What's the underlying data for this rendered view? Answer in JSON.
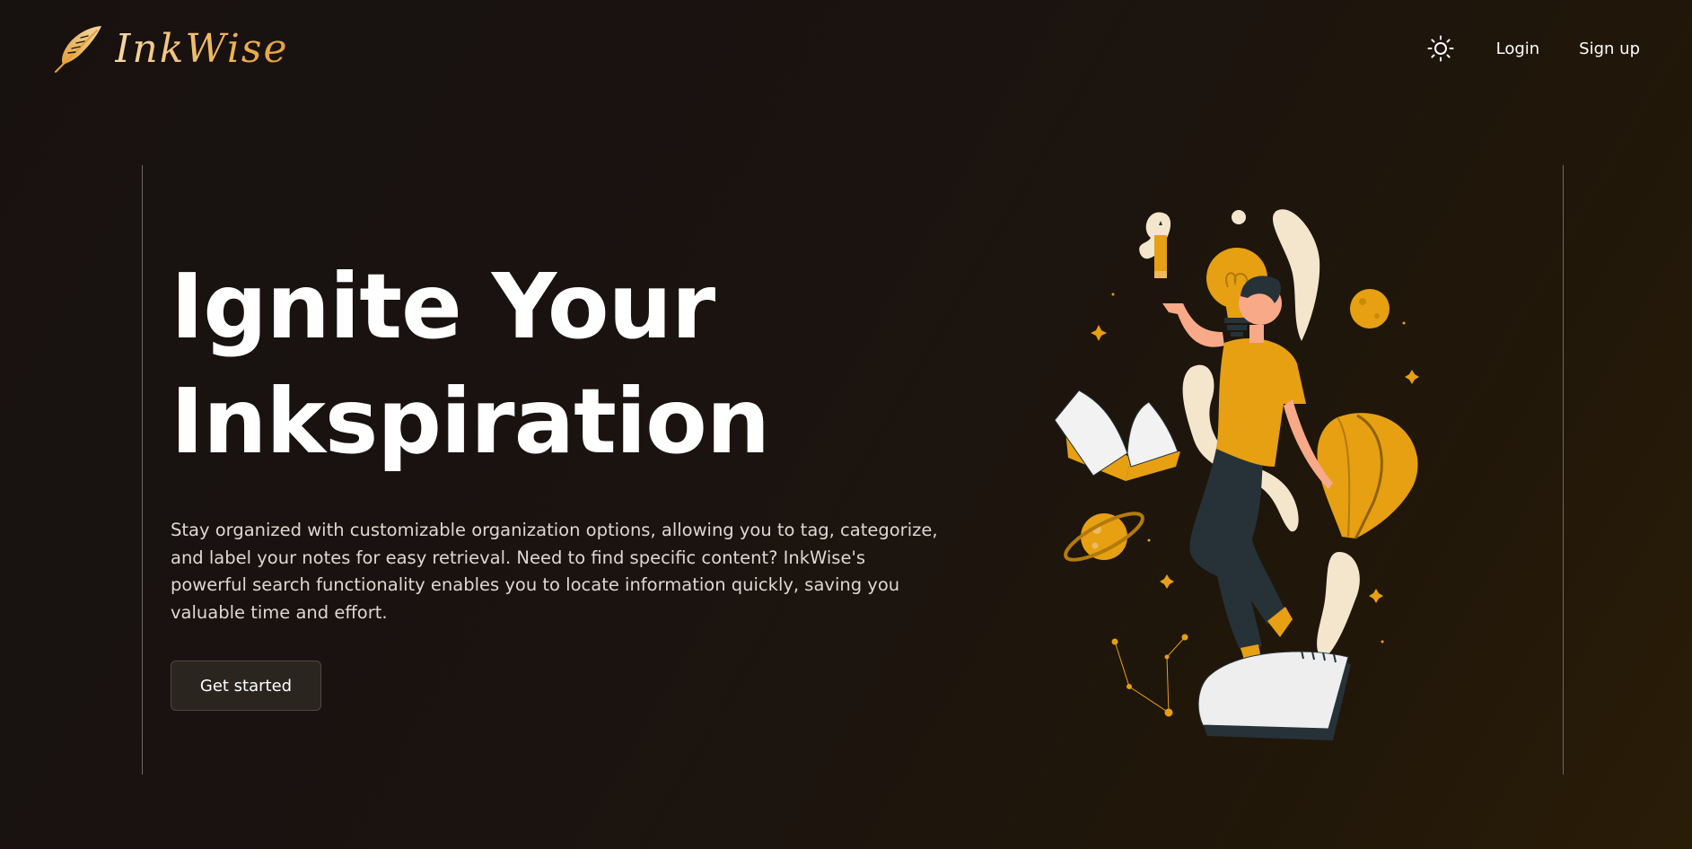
{
  "brand": {
    "name": "InkWise",
    "logo_icon": "feather-quill-icon",
    "gradient": [
      "#f5d7a4",
      "#e3a13a"
    ]
  },
  "nav": {
    "theme_icon": "sun-icon",
    "login_label": "Login",
    "signup_label": "Sign up"
  },
  "hero": {
    "headline_line1": "Ignite Your",
    "headline_line2": "Inkspiration",
    "description": "Stay organized with customizable organization options, allowing you to tag, categorize, and label your notes for easy retrieval. Need to find specific content? InkWise's powerful search functionality enables you to locate information quickly, saving you valuable time and effort.",
    "cta_label": "Get started"
  },
  "colors": {
    "accent": "#e6a012",
    "background": "#171110",
    "cream": "#f3e6cc",
    "pants": "#263238"
  }
}
